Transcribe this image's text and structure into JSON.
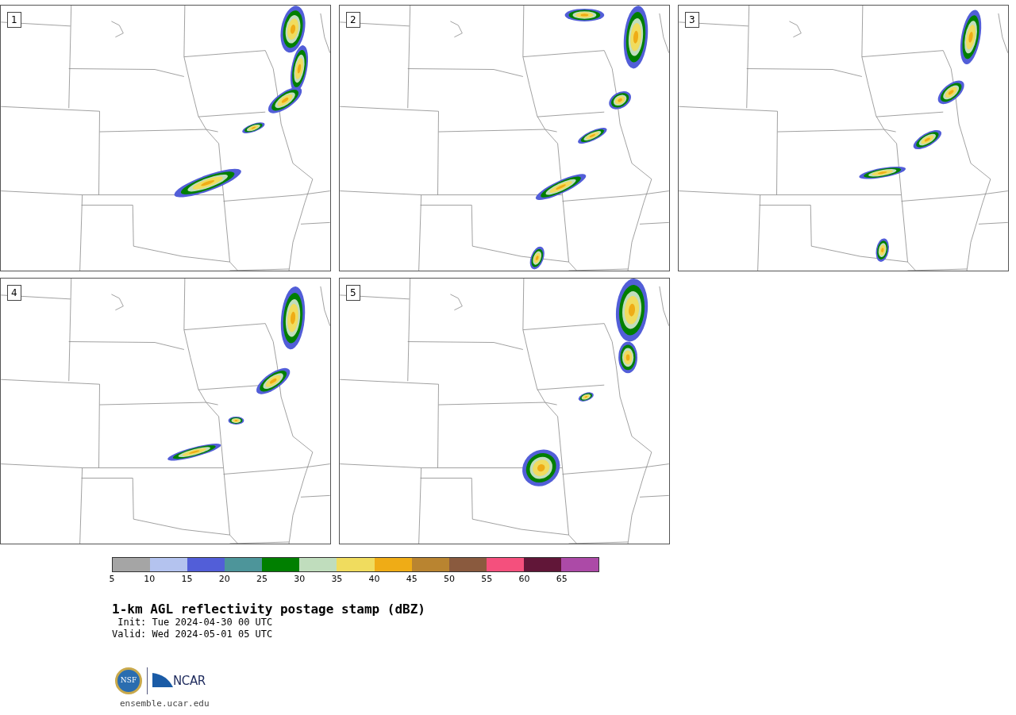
{
  "panels": [
    {
      "label": "1"
    },
    {
      "label": "2"
    },
    {
      "label": "3"
    },
    {
      "label": "4"
    },
    {
      "label": "5"
    }
  ],
  "colorbar": {
    "segments": [
      {
        "color": "#a5a5a5"
      },
      {
        "color": "#b4c3ef"
      },
      {
        "color": "#525ed8"
      },
      {
        "color": "#4d959a"
      },
      {
        "color": "#007f00"
      },
      {
        "color": "#c0ddbd"
      },
      {
        "color": "#f0dc5e"
      },
      {
        "color": "#efac16"
      },
      {
        "color": "#b98430"
      },
      {
        "color": "#8a5a3e"
      },
      {
        "color": "#f4507d"
      },
      {
        "color": "#611638"
      },
      {
        "color": "#ac4aa7"
      }
    ],
    "ticks": [
      "5",
      "10",
      "15",
      "20",
      "25",
      "30",
      "35",
      "40",
      "45",
      "50",
      "55",
      "60",
      "65"
    ]
  },
  "title": "1-km AGL reflectivity postage stamp (dBZ)",
  "init": " Init: Tue 2024-04-30 00 UTC",
  "valid": "Valid: Wed 2024-05-01 05 UTC",
  "logos": {
    "nsf": "NSF",
    "ncar": "NCAR"
  },
  "footer": "ensemble.ucar.edu"
}
